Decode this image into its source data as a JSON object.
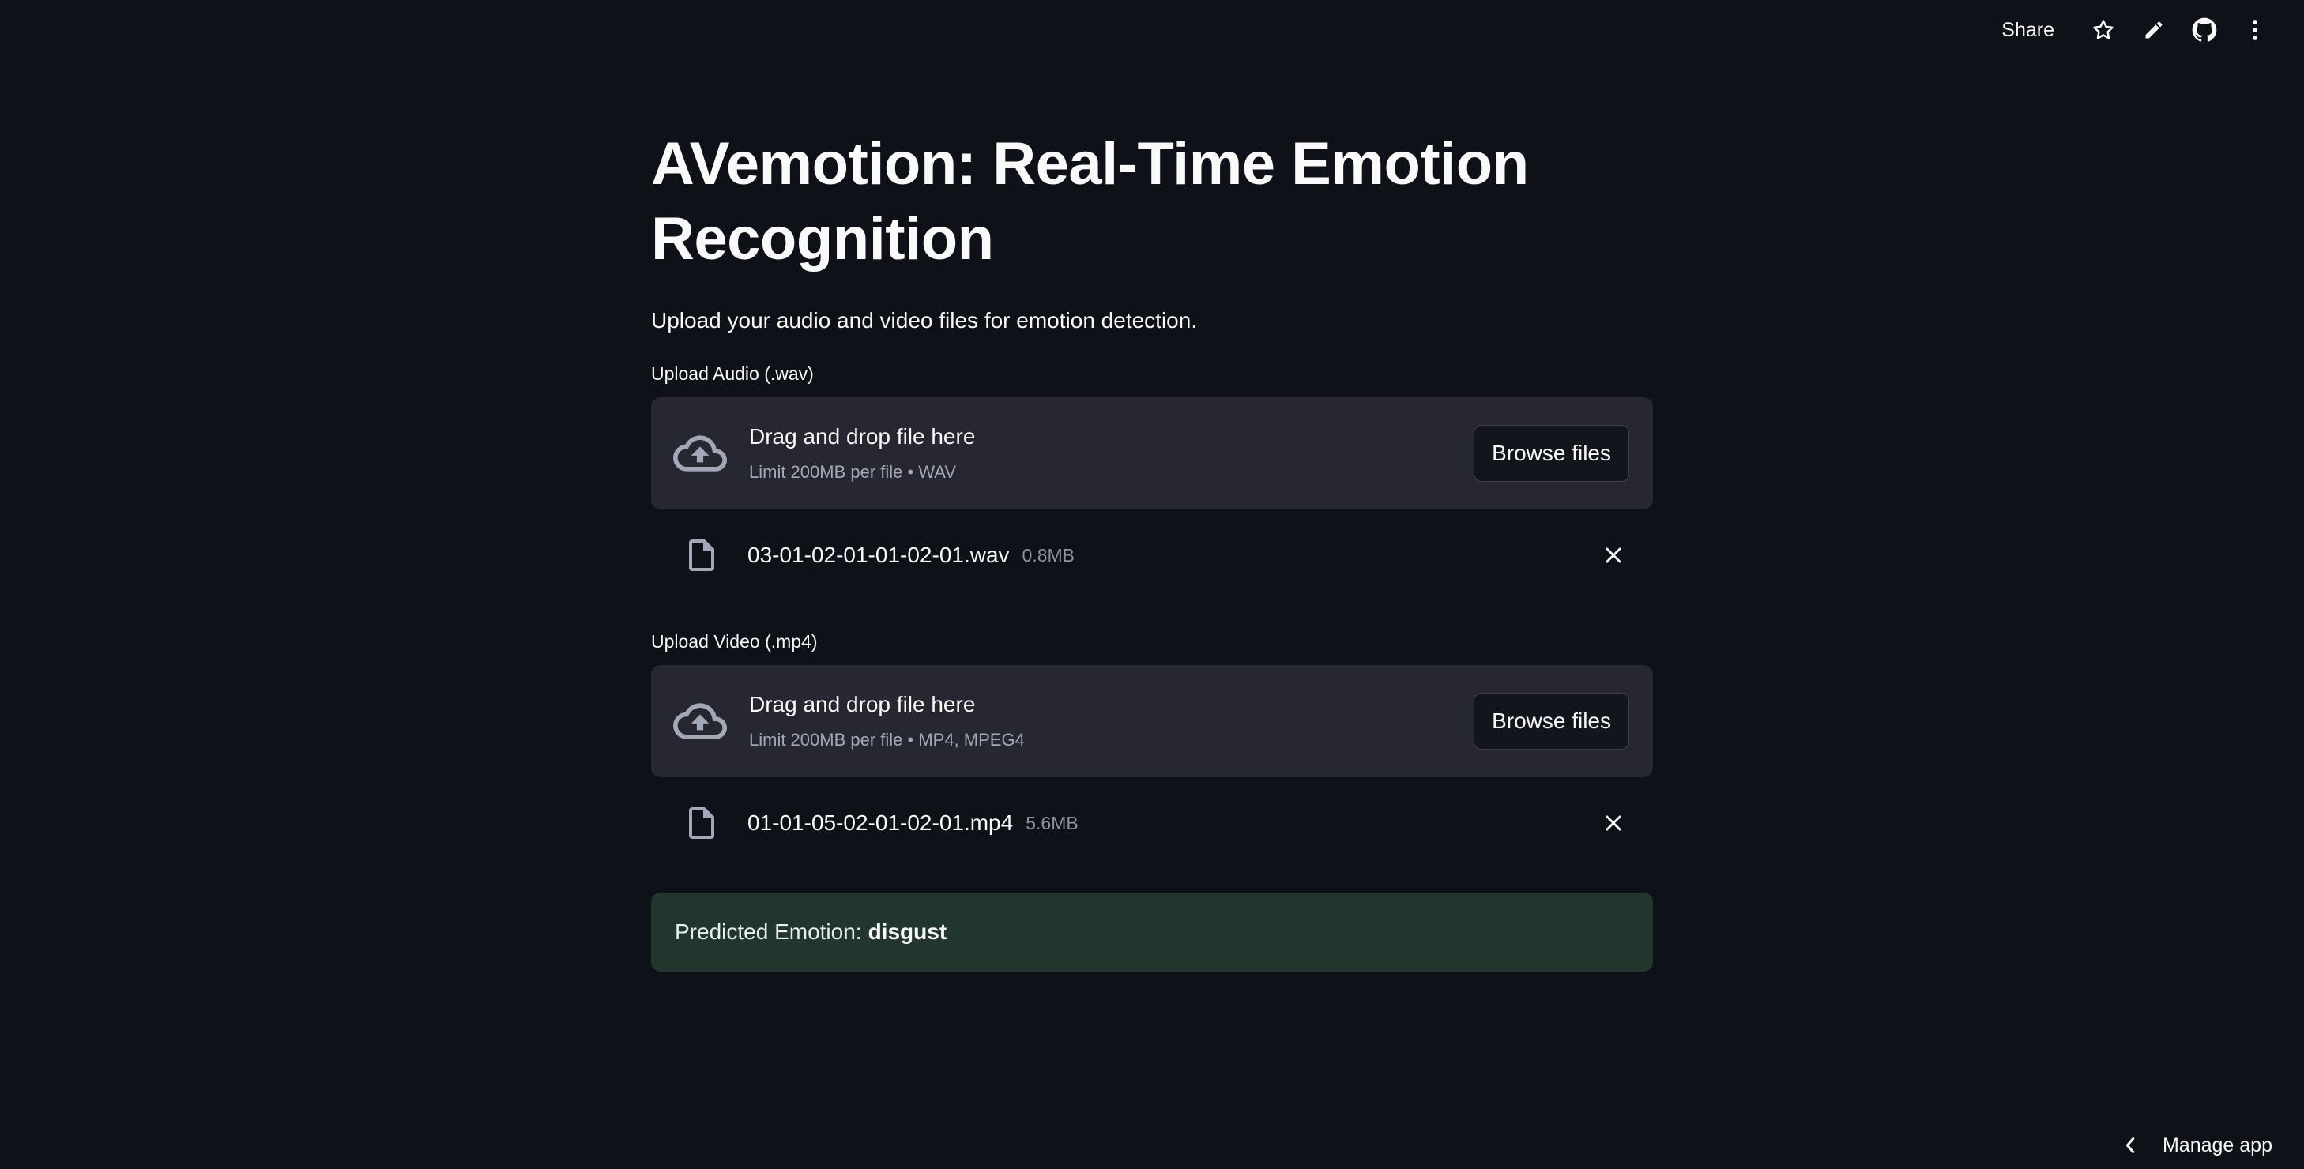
{
  "toolbar": {
    "share_label": "Share",
    "icons": [
      "star-icon",
      "pencil-icon",
      "github-icon",
      "kebab-menu-icon"
    ]
  },
  "main": {
    "title": "AVemotion: Real-Time Emotion Recognition",
    "subtitle": "Upload your audio and video files for emotion detection."
  },
  "audio_upload": {
    "label": "Upload Audio (.wav)",
    "drop_title": "Drag and drop file here",
    "limit": "Limit 200MB per file • WAV",
    "browse_label": "Browse files",
    "file": {
      "name": "03-01-02-01-01-02-01.wav",
      "size": "0.8MB"
    }
  },
  "video_upload": {
    "label": "Upload Video (.mp4)",
    "drop_title": "Drag and drop file here",
    "limit": "Limit 200MB per file • MP4, MPEG4",
    "browse_label": "Browse files",
    "file": {
      "name": "01-01-05-02-01-02-01.mp4",
      "size": "5.6MB"
    }
  },
  "result": {
    "prefix": "Predicted Emotion:",
    "value": "disgust"
  },
  "footer": {
    "manage_label": "Manage app"
  },
  "colors": {
    "background": "#0e1117",
    "dropzone": "#262730",
    "success_bg": "#21362c"
  }
}
